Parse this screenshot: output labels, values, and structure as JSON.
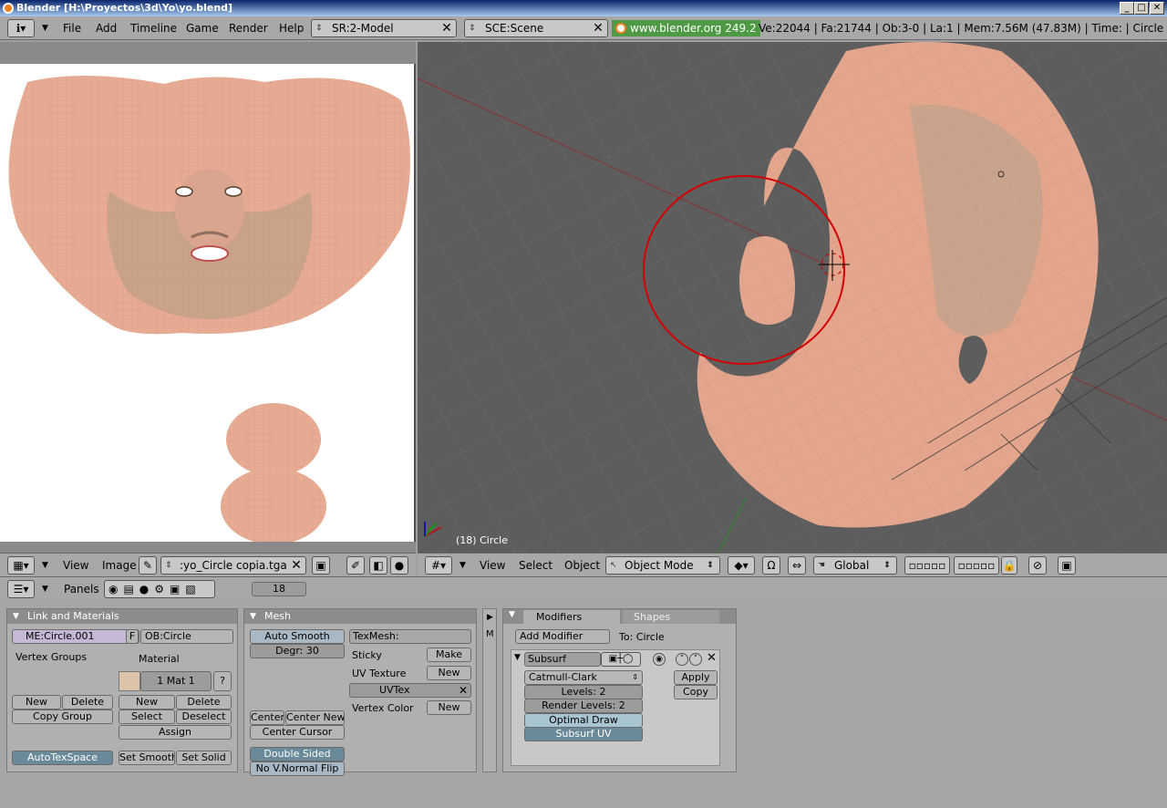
{
  "window": {
    "title": "Blender [H:\\Proyectos\\3d\\Yo\\yo.blend]"
  },
  "topbar": {
    "menus": [
      "File",
      "Add",
      "Timeline",
      "Game",
      "Render",
      "Help"
    ],
    "screen": "SR:2-Model",
    "scene": "SCE:Scene",
    "url": "www.blender.org 249.2",
    "stats": "Ve:22044 | Fa:21744 | Ob:3-0 | La:1  | Mem:7.56M (47.83M) | Time: | Circle"
  },
  "uv_editor": {
    "menus": [
      "View",
      "Image"
    ],
    "image_name": ":yo_Circle copia.tga"
  },
  "viewport": {
    "object_label": "(18) Circle",
    "menus": [
      "View",
      "Select",
      "Object"
    ],
    "mode": "Object Mode",
    "orientation": "Global"
  },
  "buttons_header": {
    "panels_label": "Panels",
    "frame": "18"
  },
  "link_materials": {
    "title": "Link and Materials",
    "mesh_name": "ME:Circle.001",
    "f_label": "F",
    "object_name": "OB:Circle",
    "vertex_groups_label": "Vertex Groups",
    "material_label": "Material",
    "mat_slot": "1 Mat 1",
    "question": "?",
    "vg_new": "New",
    "vg_delete": "Delete",
    "copy_group": "Copy Group",
    "mat_new": "New",
    "mat_delete": "Delete",
    "mat_select": "Select",
    "mat_deselect": "Deselect",
    "assign": "Assign",
    "autotexspace": "AutoTexSpace",
    "set_smooth": "Set Smooth",
    "set_solid": "Set Solid"
  },
  "mesh": {
    "title": "Mesh",
    "auto_smooth": "Auto Smooth",
    "degr": "Degr: 30",
    "texmesh": "TexMesh:",
    "sticky": "Sticky",
    "sticky_make": "Make",
    "uv_texture": "UV Texture",
    "uv_new": "New",
    "uvtex": "UVTex",
    "vertex_color": "Vertex Color",
    "vc_new": "New",
    "center": "Center",
    "center_new": "Center New",
    "center_cursor": "Center Cursor",
    "double_sided": "Double Sided",
    "no_vnormal_flip": "No V.Normal Flip"
  },
  "modifiers": {
    "tab_modifiers": "Modifiers",
    "tab_shapes": "Shapes",
    "add_modifier": "Add Modifier",
    "to": "To: Circle",
    "name": "Subsurf",
    "type": "Catmull-Clark",
    "levels": "Levels: 2",
    "render_levels": "Render Levels: 2",
    "optimal_draw": "Optimal Draw",
    "subsurf_uv": "Subsurf UV",
    "apply": "Apply",
    "copy": "Copy"
  },
  "colors": {
    "skin": "#e3a68c",
    "viewport_bg": "#5d5d5d",
    "selection_circle": "#d40000"
  }
}
